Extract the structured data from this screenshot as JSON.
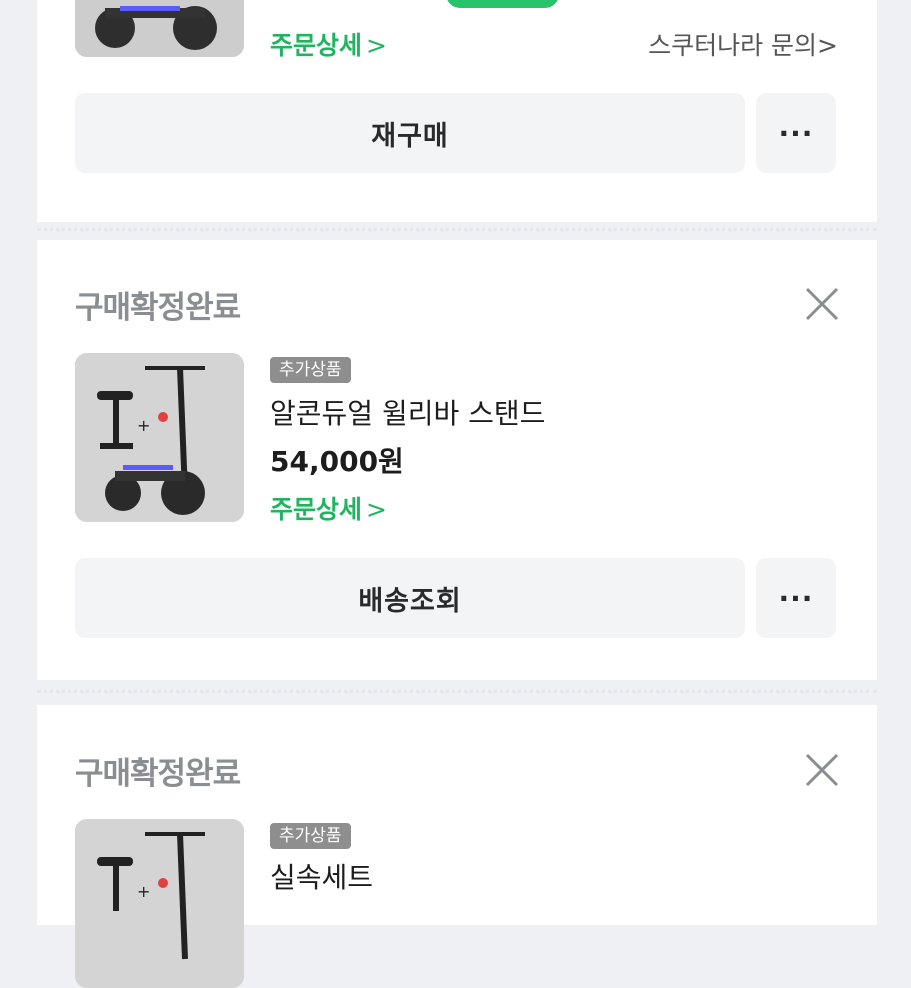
{
  "top_item": {
    "order_detail": "주문상세",
    "inquiry": "스쿠터나라 문의",
    "rebuy_button": "재구매",
    "more_button": "···"
  },
  "items": [
    {
      "status": "구매확정완료",
      "badge": "추가상품",
      "name": "알콘듀얼 윌리바 스탠드",
      "price": "54,000원",
      "order_detail": "주문상세",
      "action_button": "배송조회",
      "more_button": "···"
    },
    {
      "status": "구매확정완료",
      "badge": "추가상품",
      "name": "실속세트",
      "price": "",
      "order_detail": "",
      "action_button": "",
      "more_button": ""
    }
  ],
  "colors": {
    "accent_green": "#21b460",
    "status_grey": "#8a8d91",
    "button_bg": "#f3f4f6",
    "page_bg": "#eef0f3"
  },
  "icons": [
    "close-icon",
    "chevron-right-icon",
    "more-icon",
    "product-thumbnail"
  ]
}
